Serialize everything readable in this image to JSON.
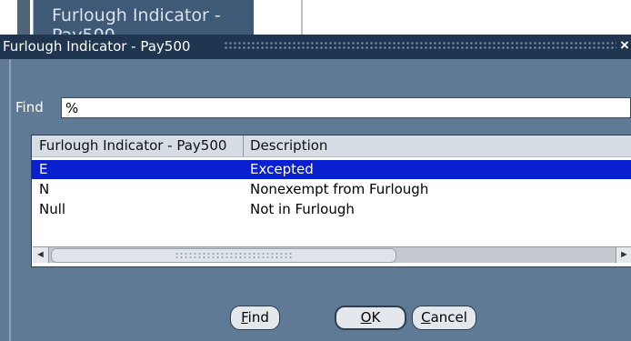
{
  "background": {
    "field_label": "Furlough Indicator - Pay500"
  },
  "dialog": {
    "title": "Furlough Indicator - Pay500",
    "close_symbol": "×"
  },
  "find": {
    "label": "Find",
    "value": "%"
  },
  "list": {
    "columns": [
      "Furlough Indicator - Pay500",
      "Description"
    ],
    "rows": [
      {
        "code": "E",
        "description": "Excepted",
        "selected": true
      },
      {
        "code": "N",
        "description": "Nonexempt from Furlough",
        "selected": false
      },
      {
        "code": "Null",
        "description": "Not in Furlough",
        "selected": false
      }
    ]
  },
  "buttons": {
    "find": {
      "rest": "ind",
      "mnemonic": "F"
    },
    "ok": {
      "rest": "K",
      "mnemonic": "O"
    },
    "cancel": {
      "rest": "ancel",
      "mnemonic": "C"
    }
  },
  "icons": {
    "scroll_left": "◄",
    "scroll_right": "►"
  },
  "colors": {
    "selection": "#0a1fd0",
    "dialog_bg": "#5f7a95",
    "titlebar": "#1f3550"
  }
}
